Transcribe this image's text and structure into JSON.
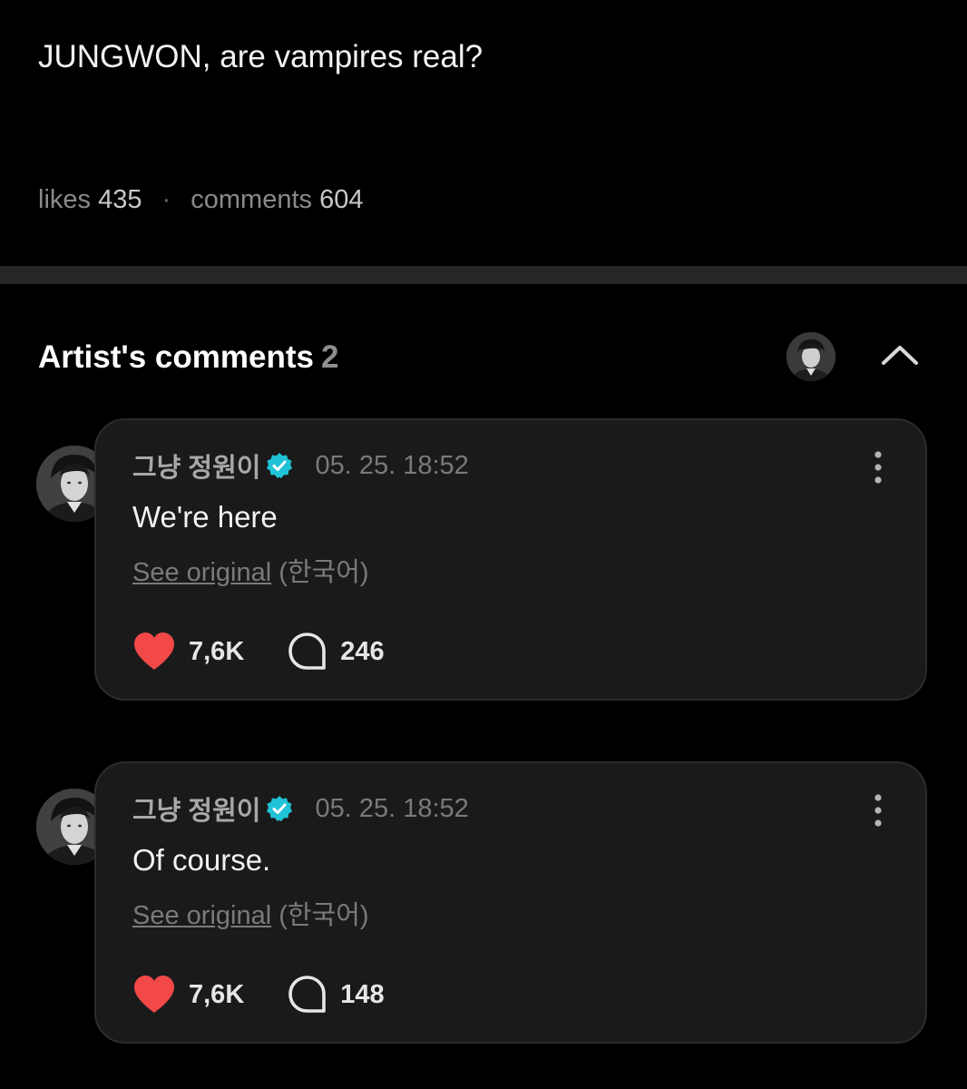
{
  "post": {
    "title": "JUNGWON, are vampires real?",
    "likes_label": "likes",
    "likes_count": "435",
    "separator": "·",
    "comments_label": "comments",
    "comments_count": "604"
  },
  "artist_comments": {
    "title": "Artist's comments",
    "count": "2",
    "collapse_icon": "chevron-up-icon",
    "comments": [
      {
        "author": "그냥 정원이",
        "verified_icon": "verified-badge-icon",
        "time": "05. 25. 18:52",
        "text": "We're here",
        "see_original": "See original",
        "original_lang": "(한국어)",
        "likes": "7,6K",
        "replies": "246"
      },
      {
        "author": "그냥 정원이",
        "verified_icon": "verified-badge-icon",
        "time": "05. 25. 18:52",
        "text": "Of course.",
        "see_original": "See original",
        "original_lang": "(한국어)",
        "likes": "7,6K",
        "replies": "148"
      }
    ]
  },
  "colors": {
    "background": "#000000",
    "card": "#1a1a1a",
    "heart": "#f24848",
    "verified": "#1fc2d6"
  }
}
